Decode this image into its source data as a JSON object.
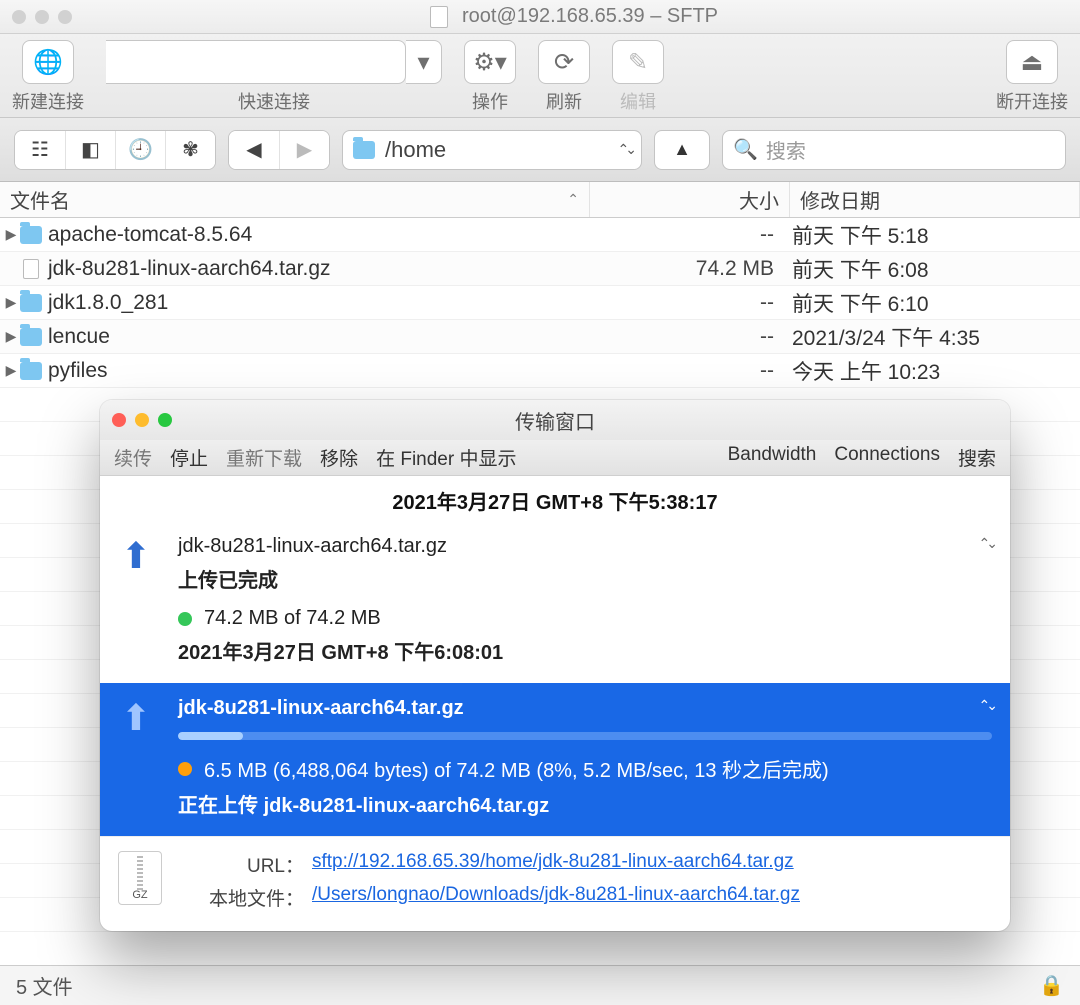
{
  "window": {
    "title": "root@192.168.65.39 – SFTP"
  },
  "toolbar": {
    "new_conn": "新建连接",
    "quick_conn": "快速连接",
    "actions": "操作",
    "refresh": "刷新",
    "edit": "编辑",
    "disconnect": "断开连接"
  },
  "nav": {
    "path": "/home",
    "search_placeholder": "搜索"
  },
  "columns": {
    "name": "文件名",
    "size": "大小",
    "date": "修改日期"
  },
  "files": [
    {
      "name": "apache-tomcat-8.5.64",
      "type": "folder",
      "size": "--",
      "date": "前天 下午 5:18"
    },
    {
      "name": "jdk-8u281-linux-aarch64.tar.gz",
      "type": "file",
      "size": "74.2 MB",
      "date": "前天 下午 6:08"
    },
    {
      "name": "jdk1.8.0_281",
      "type": "folder",
      "size": "--",
      "date": "前天 下午 6:10"
    },
    {
      "name": "lencue",
      "type": "folder",
      "size": "--",
      "date": "2021/3/24 下午 4:35"
    },
    {
      "name": "pyfiles",
      "type": "folder",
      "size": "--",
      "date": "今天 上午 10:23"
    }
  ],
  "status": {
    "count": "5 文件"
  },
  "transfer": {
    "title": "传输窗口",
    "tb": {
      "resume": "续传",
      "stop": "停止",
      "redo": "重新下载",
      "remove": "移除",
      "reveal": "在 Finder 中显示",
      "bandwidth": "Bandwidth",
      "connections": "Connections",
      "search": "搜索"
    },
    "group_time": "2021年3月27日 GMT+8 下午5:38:17",
    "done": {
      "file": "jdk-8u281-linux-aarch64.tar.gz",
      "status": "上传已完成",
      "bytes": "74.2 MB of 74.2 MB",
      "time": "2021年3月27日 GMT+8 下午6:08:01"
    },
    "active": {
      "file": "jdk-8u281-linux-aarch64.tar.gz",
      "progress_pct": 8,
      "bytes": "6.5 MB (6,488,064 bytes) of 74.2 MB (8%, 5.2 MB/sec, 13 秒之后完成)",
      "status_prefix": "正在上传 ",
      "status_file": "jdk-8u281-linux-aarch64.tar.gz"
    },
    "details": {
      "url_label": "URL：",
      "url": "sftp://192.168.65.39/home/jdk-8u281-linux-aarch64.tar.gz",
      "local_label": "本地文件：",
      "local": "/Users/longnao/Downloads/jdk-8u281-linux-aarch64.tar.gz",
      "badge": "GZ"
    }
  }
}
